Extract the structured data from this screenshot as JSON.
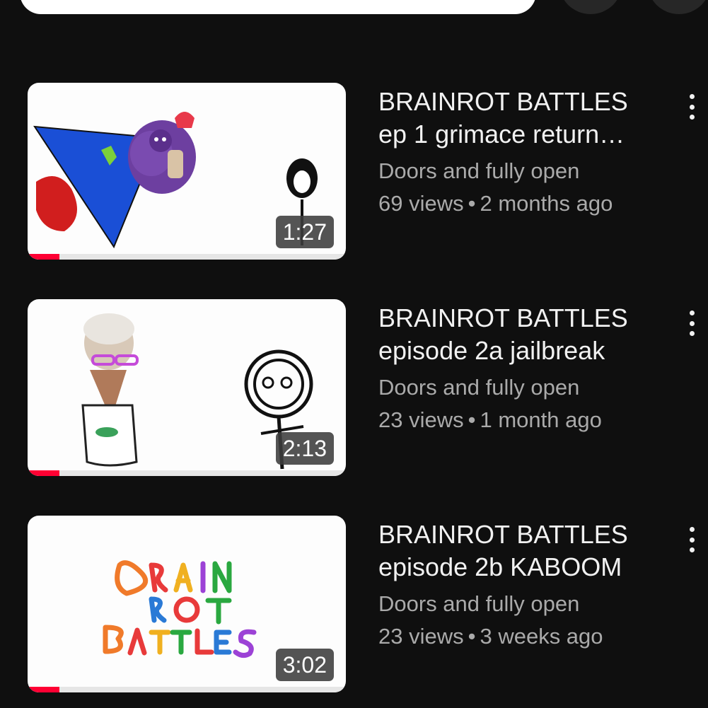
{
  "colors": {
    "background": "#0f0f0f",
    "accent": "#ff0033",
    "text_primary": "#f1f1f1",
    "text_secondary": "#aaaaaa"
  },
  "videos": [
    {
      "title_line1": "BRAINROT BATTLES",
      "title_line2": "ep 1 grimace return…",
      "channel": "Doors and fully open",
      "views": "69 views",
      "separator": "•",
      "age": "2 months ago",
      "duration": "1:27",
      "watched_fraction": 0.1,
      "menu_icon": "more-vert-icon"
    },
    {
      "title_line1": "BRAINROT BATTLES",
      "title_line2": "episode 2a jailbreak",
      "channel": "Doors and fully open",
      "views": "23 views",
      "separator": "•",
      "age": "1 month ago",
      "duration": "2:13",
      "watched_fraction": 0.1,
      "menu_icon": "more-vert-icon"
    },
    {
      "title_line1": "BRAINROT BATTLES",
      "title_line2": "episode 2b KABOOM",
      "channel": "Doors and fully open",
      "views": "23 views",
      "separator": "•",
      "age": "3 weeks ago",
      "duration": "3:02",
      "watched_fraction": 0.1,
      "menu_icon": "more-vert-icon"
    }
  ]
}
